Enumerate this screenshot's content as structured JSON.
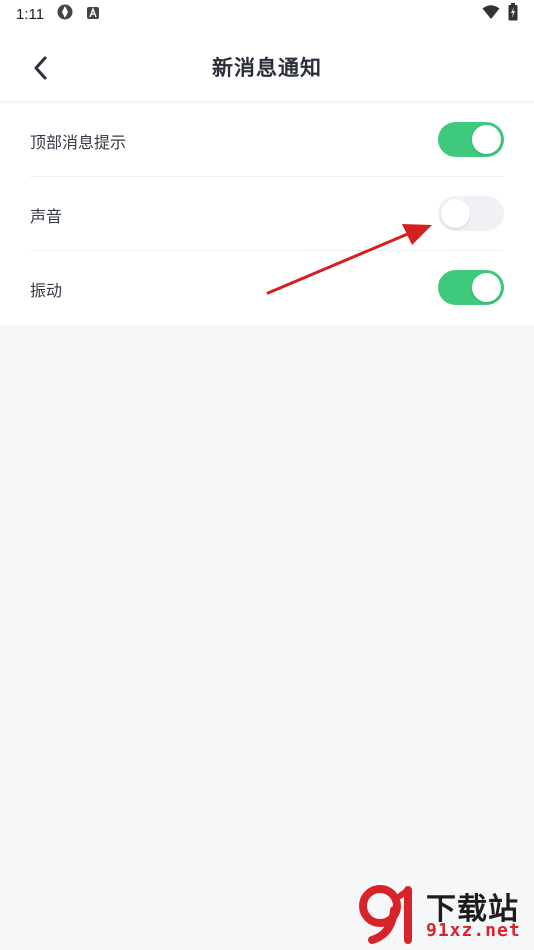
{
  "status_bar": {
    "time": "1:11"
  },
  "header": {
    "title": "新消息通知"
  },
  "settings": [
    {
      "label": "顶部消息提示",
      "enabled": true
    },
    {
      "label": "声音",
      "enabled": false
    },
    {
      "label": "振动",
      "enabled": true
    }
  ],
  "colors": {
    "toggle_on": "#3ec97d",
    "toggle_off": "#f0f1f4",
    "arrow": "#d42020"
  },
  "watermark": {
    "text": "下载站",
    "url": "91xz.net"
  }
}
